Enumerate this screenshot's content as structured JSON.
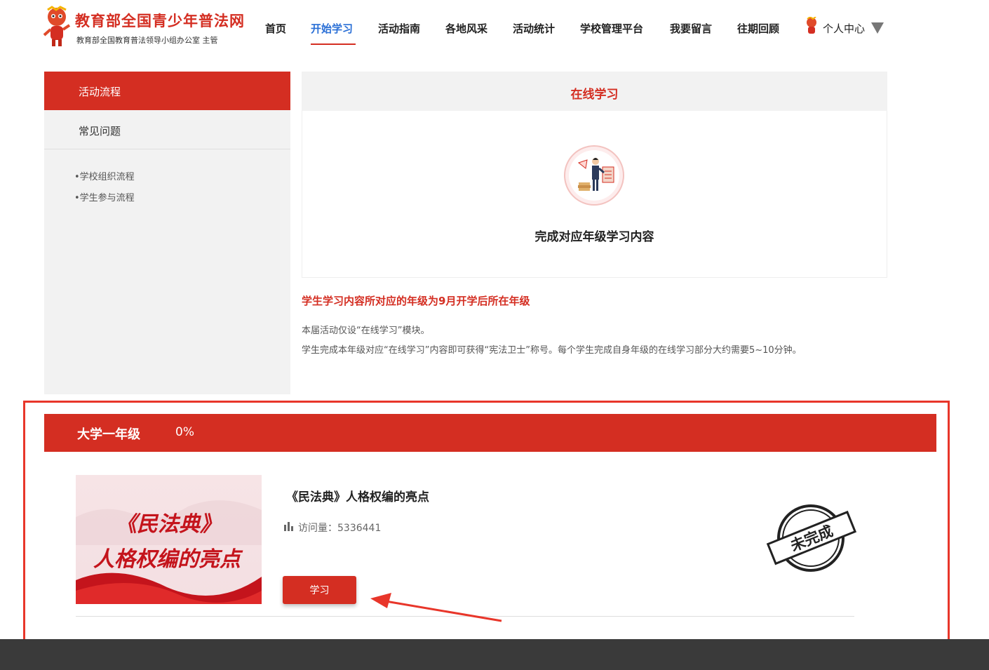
{
  "header": {
    "site_title": "教育部全国青少年普法网",
    "site_subtitle": "教育部全国教育普法领导小组办公室 主管",
    "nav": [
      {
        "label": "首页"
      },
      {
        "label": "开始学习"
      },
      {
        "label": "活动指南"
      },
      {
        "label": "各地风采"
      },
      {
        "label": "活动统计"
      },
      {
        "label": "学校管理平台"
      },
      {
        "label": "我要留言"
      },
      {
        "label": "往期回顾"
      }
    ],
    "active_nav": "开始学习",
    "user_center": "个人中心"
  },
  "sidebar": {
    "active_item": "活动流程",
    "faq_item": "常见问题",
    "links": [
      "•学校组织流程",
      "•学生参与流程"
    ]
  },
  "panel": {
    "title": "在线学习",
    "icon": "study-guide-icon",
    "caption": "完成对应年级学习内容"
  },
  "notice": {
    "highlight": "学生学习内容所对应的年级为9月开学后所在年级",
    "lines": [
      "本届活动仅设“在线学习”模块。",
      "学生完成本年级对应“在线学习”内容即可获得“宪法卫士”称号。每个学生完成自身年级的在线学习部分大约需要5~10分钟。"
    ]
  },
  "grade": {
    "name": "大学一年级",
    "progress": "0%"
  },
  "course": {
    "thumb_line1": "《民法典》",
    "thumb_line2": "人格权编的亮点",
    "title": "《民法典》人格权编的亮点",
    "views_label": "访问量：",
    "views": "5336441",
    "button": "学习",
    "status": "未完成"
  },
  "colors": {
    "brand_red": "#d42e22",
    "active_nav": "#2a6fd6",
    "annotation": "#e8362a"
  }
}
